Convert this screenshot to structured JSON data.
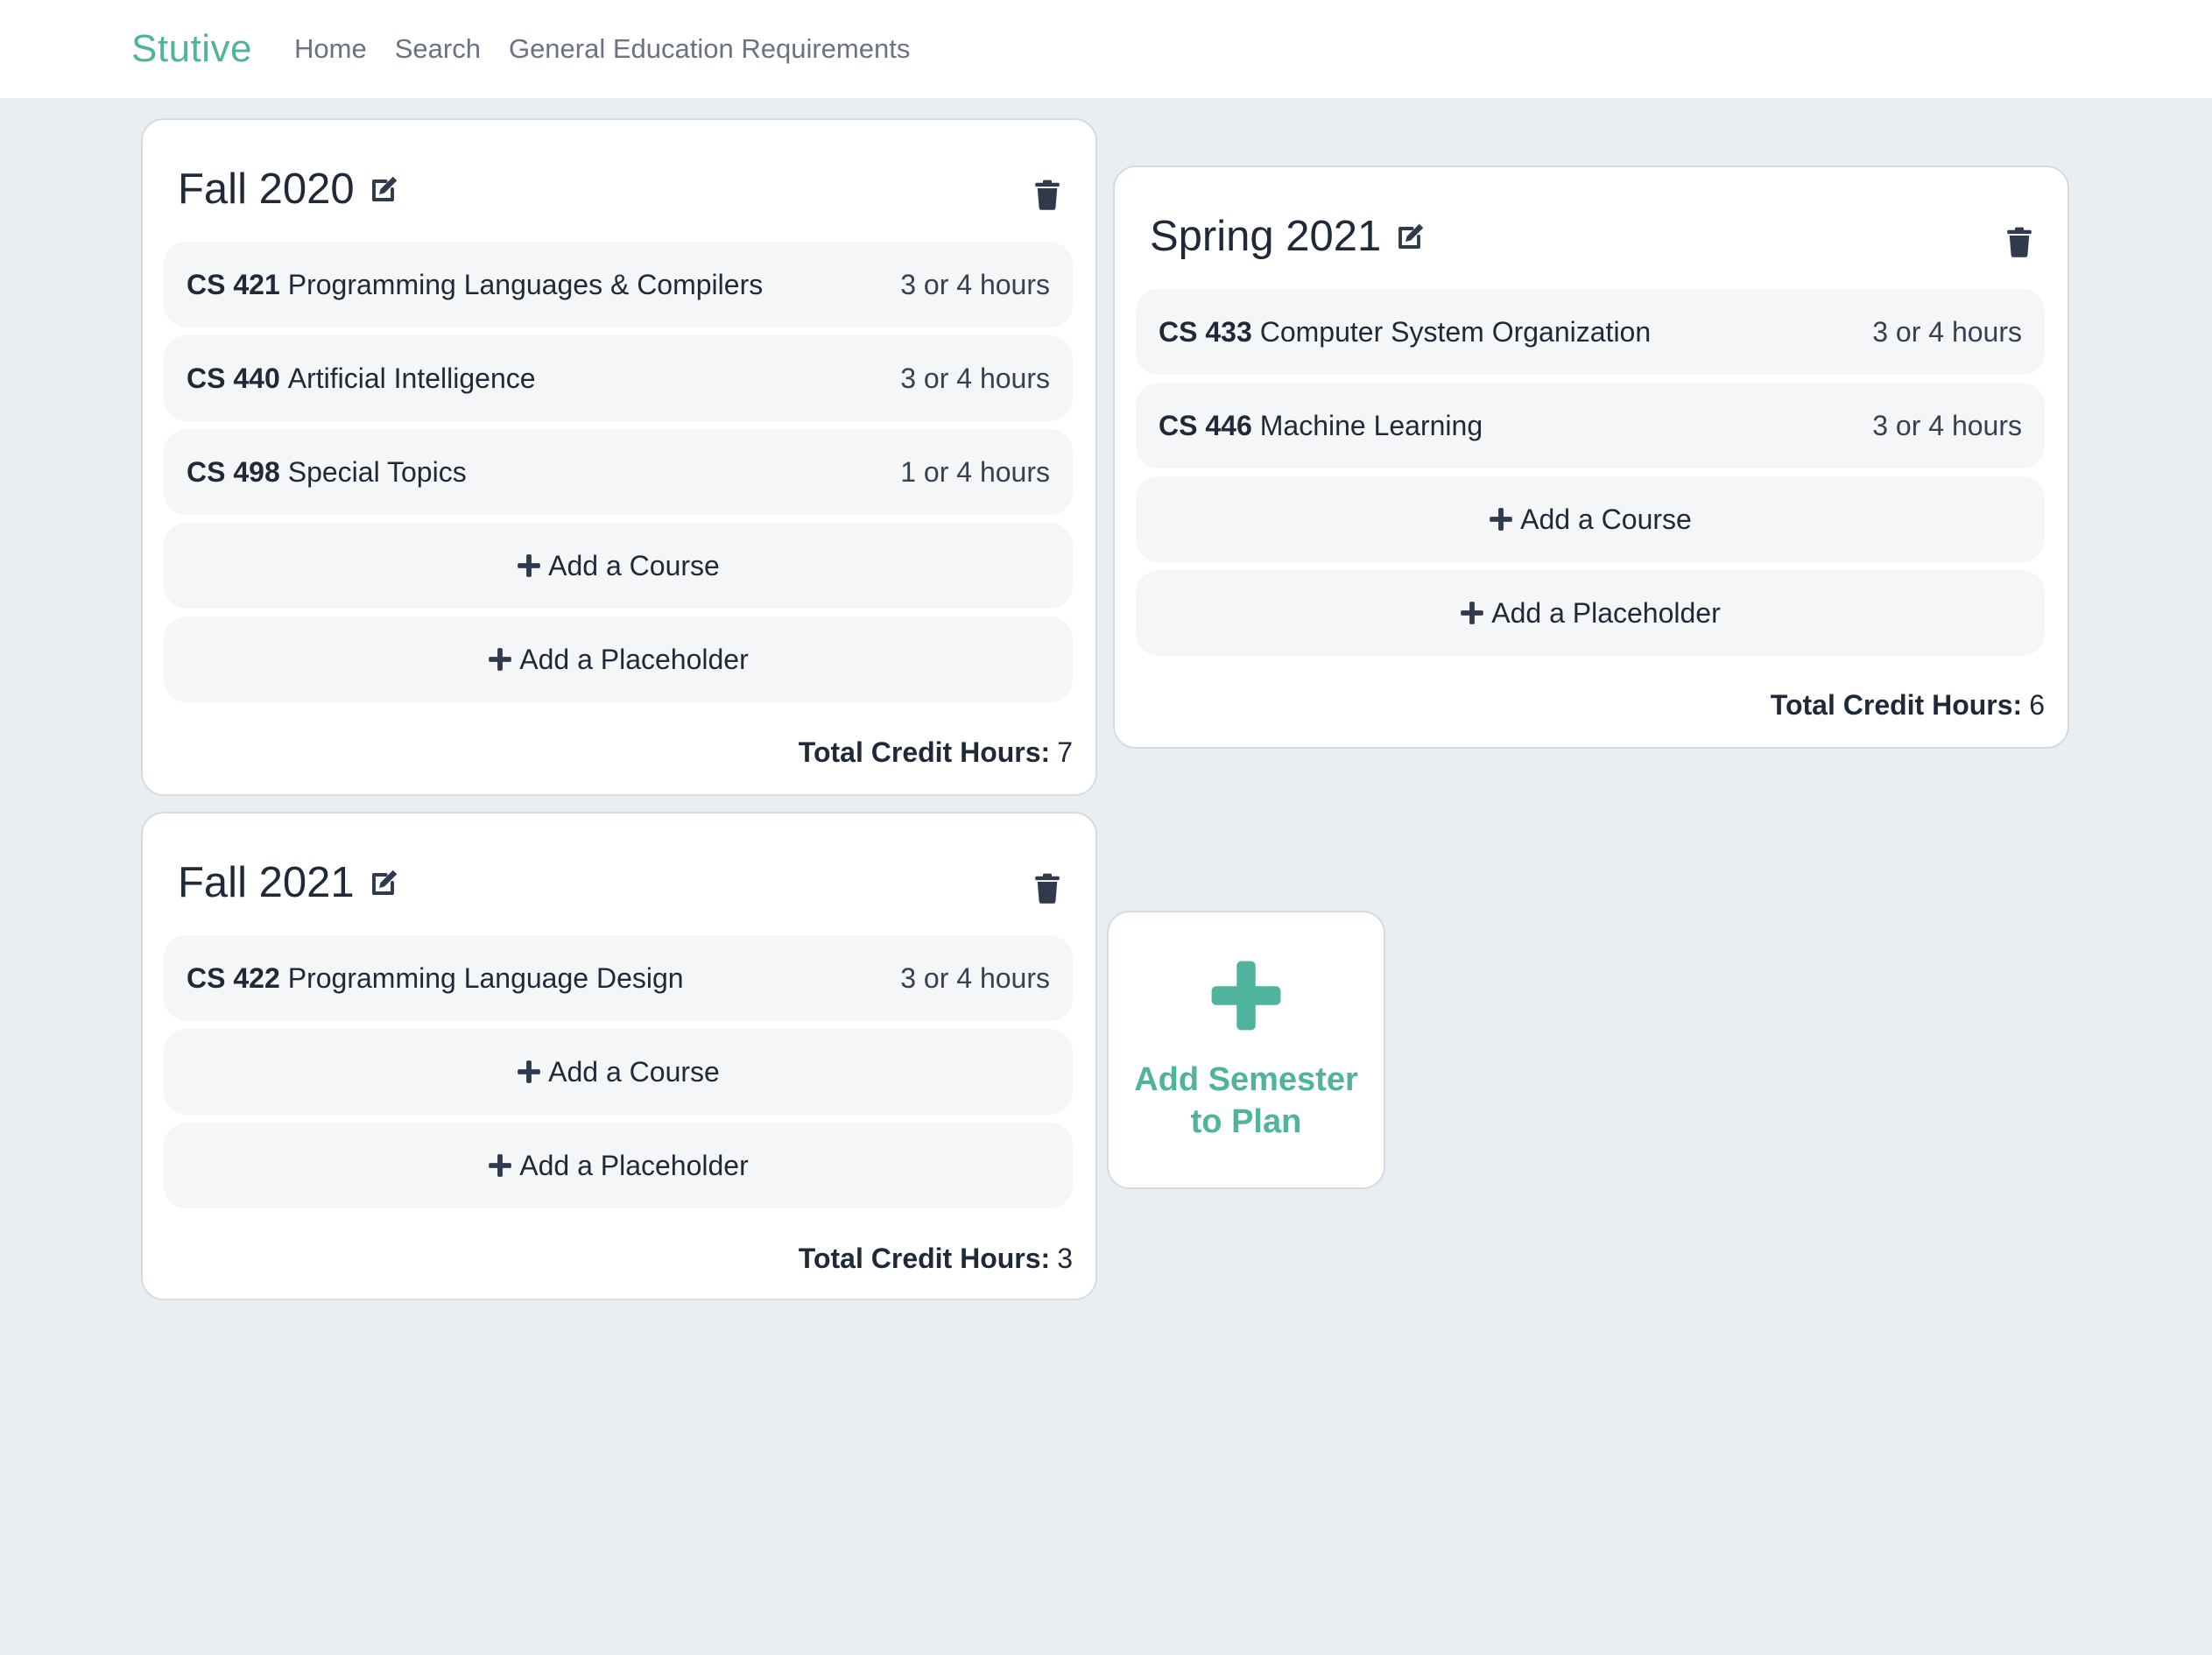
{
  "nav": {
    "brand": "Stutive",
    "links": [
      "Home",
      "Search",
      "General Education Requirements"
    ]
  },
  "semesters": [
    {
      "title": "Fall 2020",
      "courses": [
        {
          "code": "CS 421",
          "name": "Programming Languages & Compilers",
          "hours": "3 or 4 hours"
        },
        {
          "code": "CS 440",
          "name": "Artificial Intelligence",
          "hours": "3 or 4 hours"
        },
        {
          "code": "CS 498",
          "name": "Special Topics",
          "hours": "1 or 4 hours"
        }
      ],
      "add_course": "Add a Course",
      "add_placeholder": "Add a Placeholder",
      "total_label": "Total Credit Hours:",
      "total_value": "7"
    },
    {
      "title": "Spring 2021",
      "courses": [
        {
          "code": "CS 433",
          "name": "Computer System Organization",
          "hours": "3 or 4 hours"
        },
        {
          "code": "CS 446",
          "name": "Machine Learning",
          "hours": "3 or 4 hours"
        }
      ],
      "add_course": "Add a Course",
      "add_placeholder": "Add a Placeholder",
      "total_label": "Total Credit Hours:",
      "total_value": "6"
    },
    {
      "title": "Fall 2021",
      "courses": [
        {
          "code": "CS 422",
          "name": "Programming Language Design",
          "hours": "3 or 4 hours"
        }
      ],
      "add_course": "Add a Course",
      "add_placeholder": "Add a Placeholder",
      "total_label": "Total Credit Hours:",
      "total_value": "3"
    }
  ],
  "add_semester": {
    "label": "Add Semester to Plan"
  },
  "colors": {
    "accent": "#4fb49b",
    "background": "#e9eef3",
    "row": "#f4f6f8",
    "icon": "#2f3b4c"
  },
  "icons": {
    "edit": "edit-icon",
    "trash": "trash-icon",
    "plus": "plus-icon"
  }
}
